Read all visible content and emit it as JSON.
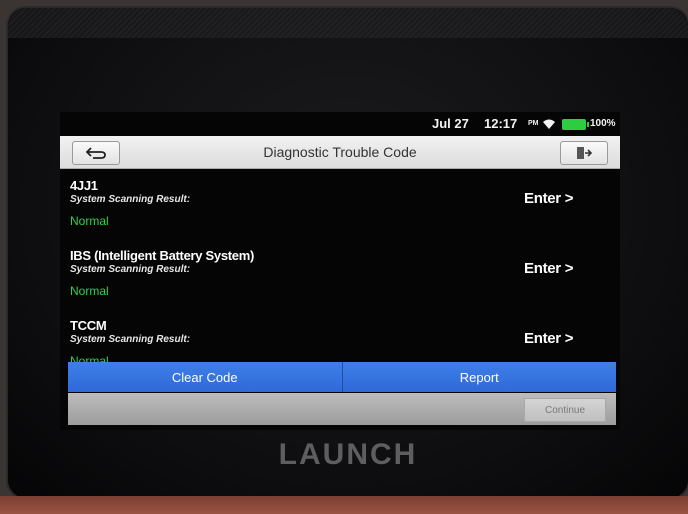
{
  "status": {
    "date": "Jul 27",
    "time": "12:17",
    "ampm": "PM",
    "battery": "100%",
    "battery_color": "#2ecc40"
  },
  "header": {
    "title": "Diagnostic Trouble Code",
    "back_icon": "back-arrow-icon",
    "exit_icon": "exit-icon"
  },
  "systems": [
    {
      "name": "4JJ1",
      "result_label": "System Scanning Result:",
      "status": "Normal",
      "enter": "Enter >"
    },
    {
      "name": "IBS (Intelligent Battery System)",
      "result_label": "System Scanning Result:",
      "status": "Normal",
      "enter": "Enter >"
    },
    {
      "name": "TCCM",
      "result_label": "System Scanning Result:",
      "status": "Normal",
      "enter": "Enter >"
    }
  ],
  "actions": {
    "clear_code": "Clear Code",
    "report": "Report",
    "continue": "Continue",
    "accent": "#3a78e4"
  },
  "brand": "LAUNCH"
}
